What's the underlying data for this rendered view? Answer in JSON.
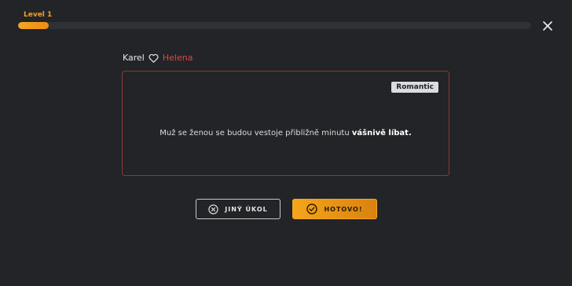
{
  "level": {
    "label": "Level 1",
    "progress_percent": 6
  },
  "players": {
    "first": "Karel",
    "second": "Helena"
  },
  "task": {
    "category": "Romantic",
    "text_plain": "Muž se ženou se budou vestoje přibližně minutu ",
    "text_bold": "vášnivě líbat."
  },
  "buttons": {
    "skip_label": "JINÝ ÚKOL",
    "done_label": "HOTOVO!"
  },
  "icons": {
    "close": "close-icon",
    "heart": "heart-icon",
    "skip": "x-circle-icon",
    "done": "check-circle-icon"
  },
  "colors": {
    "accent": "#f5a623",
    "second_player": "#e0463f",
    "card_border": "#8d3a34",
    "background": "#222427"
  }
}
